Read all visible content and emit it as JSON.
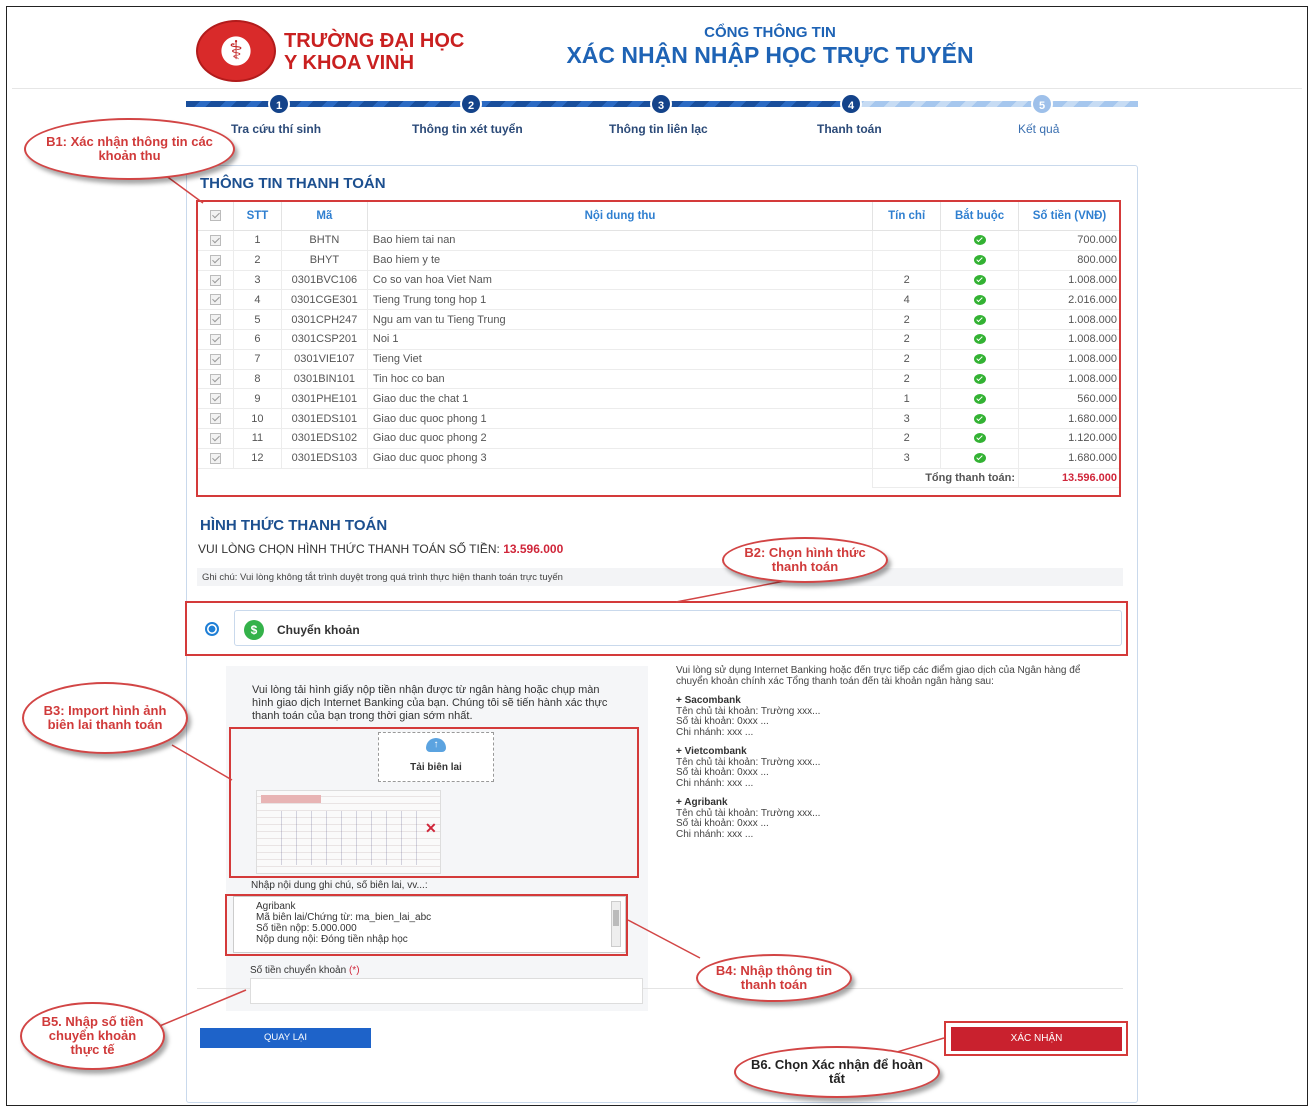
{
  "header": {
    "school_line1": "TRƯỜNG ĐẠI HỌC",
    "school_line2": "Y KHOA VINH",
    "portal_sub": "CỔNG THÔNG TIN",
    "portal_main": "XÁC NHẬN NHẬP HỌC TRỰC TUYẾN",
    "logo_icon": "caduceus-logo"
  },
  "steps": [
    {
      "num": "1",
      "label": "Tra cứu thí sinh"
    },
    {
      "num": "2",
      "label": "Thông tin xét tuyển"
    },
    {
      "num": "3",
      "label": "Thông tin liên lạc"
    },
    {
      "num": "4",
      "label": "Thanh toán"
    },
    {
      "num": "5",
      "label": "Kết quả"
    }
  ],
  "payment_info": {
    "title": "THÔNG TIN THANH TOÁN",
    "columns": [
      "STT",
      "Mã",
      "Nội dung thu",
      "Tín chỉ",
      "Bắt buộc",
      "Số tiền (VNĐ)"
    ],
    "rows": [
      {
        "stt": "1",
        "ma": "BHTN",
        "noidung": "Bao hiem tai nan",
        "tinchi": "",
        "sotien": "700.000"
      },
      {
        "stt": "2",
        "ma": "BHYT",
        "noidung": "Bao hiem y te",
        "tinchi": "",
        "sotien": "800.000"
      },
      {
        "stt": "3",
        "ma": "0301BVC106",
        "noidung": "Co so van hoa Viet Nam",
        "tinchi": "2",
        "sotien": "1.008.000"
      },
      {
        "stt": "4",
        "ma": "0301CGE301",
        "noidung": "Tieng Trung tong hop 1",
        "tinchi": "4",
        "sotien": "2.016.000"
      },
      {
        "stt": "5",
        "ma": "0301CPH247",
        "noidung": "Ngu am van tu Tieng Trung",
        "tinchi": "2",
        "sotien": "1.008.000"
      },
      {
        "stt": "6",
        "ma": "0301CSP201",
        "noidung": "Noi 1",
        "tinchi": "2",
        "sotien": "1.008.000"
      },
      {
        "stt": "7",
        "ma": "0301VIE107",
        "noidung": "Tieng Viet",
        "tinchi": "2",
        "sotien": "1.008.000"
      },
      {
        "stt": "8",
        "ma": "0301BIN101",
        "noidung": "Tin hoc co ban",
        "tinchi": "2",
        "sotien": "1.008.000"
      },
      {
        "stt": "9",
        "ma": "0301PHE101",
        "noidung": "Giao duc the chat 1",
        "tinchi": "1",
        "sotien": "560.000"
      },
      {
        "stt": "10",
        "ma": "0301EDS101",
        "noidung": "Giao duc quoc phong 1",
        "tinchi": "3",
        "sotien": "1.680.000"
      },
      {
        "stt": "11",
        "ma": "0301EDS102",
        "noidung": "Giao duc quoc phong 2",
        "tinchi": "2",
        "sotien": "1.120.000"
      },
      {
        "stt": "12",
        "ma": "0301EDS103",
        "noidung": "Giao duc quoc phong 3",
        "tinchi": "3",
        "sotien": "1.680.000"
      }
    ],
    "total_label": "Tổng thanh toán:",
    "total_value": "13.596.000"
  },
  "payment_method": {
    "title": "HÌNH THỨC THANH TOÁN",
    "prompt": "VUI LÒNG CHỌN HÌNH THỨC THANH TOÁN SỐ TIỀN:",
    "prompt_amount": "13.596.000",
    "note": "Ghi chú: Vui lòng không tắt trình duyệt trong quá trình thực hiện thanh toán trực tuyến",
    "method_label": "Chuyển khoản",
    "instructions": "Vui lòng tải hình giấy nộp tiền nhận được từ ngân hàng hoặc chụp màn hình giao dịch Internet Banking của bạn. Chúng tôi sẽ tiến hành xác thực thanh toán của bạn trong thời gian sớm nhất.",
    "upload_label": "Tải biên lai",
    "notes_label": "Nhập nội dung ghi chú, số biên lai, vv...:",
    "notes_lines": [
      "Agribank",
      "Mã biên lai/Chứng từ: ma_bien_lai_abc",
      "Số tiền nộp: 5.000.000",
      "Nộp dung nội: Đóng tiền nhập học"
    ],
    "amount_label": "Số tiền chuyển khoản",
    "amount_required": "(*)",
    "amount_value": "",
    "bank_intro": "Vui lòng sử dụng Internet Banking hoặc đến trực tiếp các điểm giao dịch của Ngân hàng để chuyển khoản chính xác Tổng thanh toán đến tài khoản ngân hàng sau:",
    "banks": [
      {
        "name": "+ Sacombank",
        "holder": "Tên chủ tài khoản: Trường xxx...",
        "account": "Số tài khoản: 0xxx ...",
        "branch": "Chi nhánh: xxx ..."
      },
      {
        "name": "+ Vietcombank",
        "holder": "Tên chủ tài khoản: Trường xxx...",
        "account": "Số tài khoản: 0xxx ...",
        "branch": "Chi nhánh: xxx ..."
      },
      {
        "name": "+ Agribank",
        "holder": "Tên chủ tài khoản: Trường xxx...",
        "account": "Số tài khoản: 0xxx ...",
        "branch": "Chi nhánh: xxx ..."
      }
    ]
  },
  "buttons": {
    "back": "QUAY LẠI",
    "confirm": "XÁC NHẬN"
  },
  "callouts": {
    "b1": "B1: Xác nhận thông tin các khoản thu",
    "b2": "B2: Chọn hình thức thanh toán",
    "b3": "B3: Import hình ảnh biên lai thanh toán",
    "b4": "B4: Nhập thông tin thanh toán",
    "b5": "B5. Nhập số tiền chuyển khoản thực tế",
    "b6": "B6. Chọn Xác nhận để hoàn tất"
  },
  "colors": {
    "brand_red": "#c92020",
    "brand_blue": "#1e63b5",
    "annotation_red": "#d43a3a",
    "confirm_button": "#c9212e",
    "back_button": "#1e63c9"
  }
}
